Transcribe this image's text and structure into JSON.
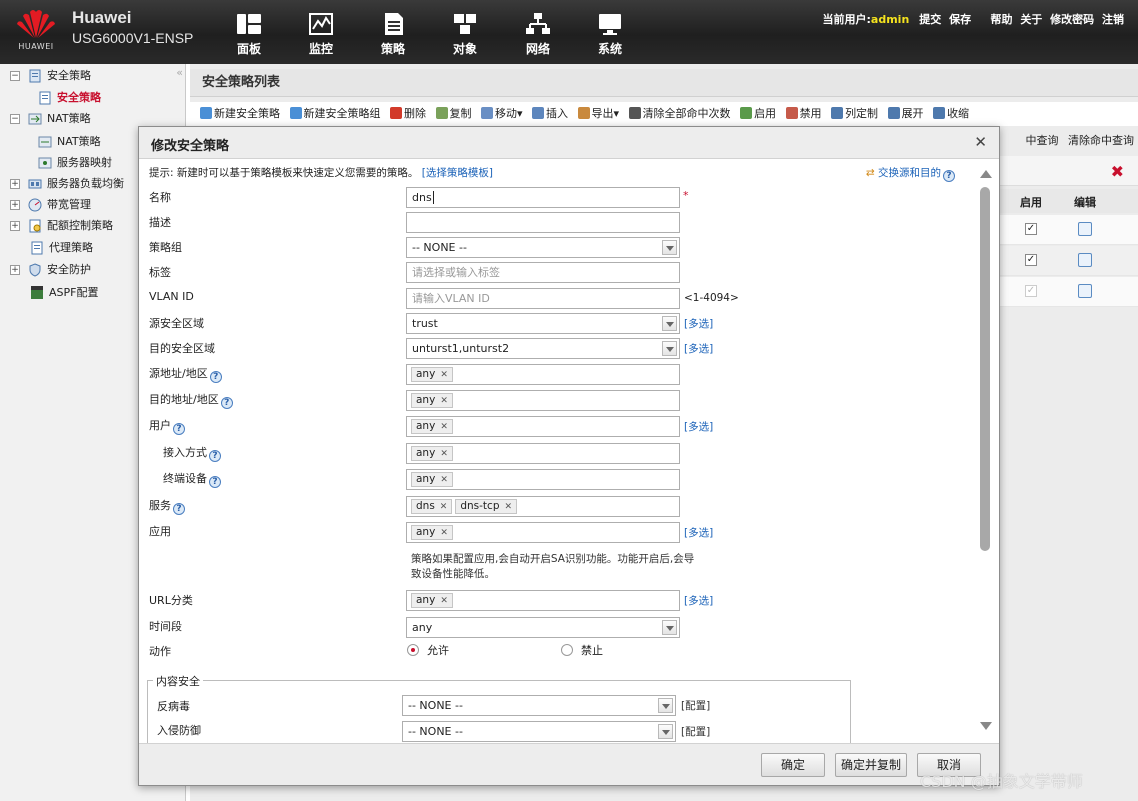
{
  "header": {
    "brand": "Huawei",
    "model": "USG6000V1-ENSP",
    "logo_text": "HUAWEI",
    "nav": [
      {
        "label": "面板",
        "icon": "dashboard-icon"
      },
      {
        "label": "监控",
        "icon": "monitor-icon"
      },
      {
        "label": "策略",
        "icon": "policy-icon"
      },
      {
        "label": "对象",
        "icon": "object-icon"
      },
      {
        "label": "网络",
        "icon": "network-icon"
      },
      {
        "label": "系统",
        "icon": "system-icon"
      }
    ],
    "current_user_label": "当前用户:",
    "current_user": "admin",
    "links": [
      "提交",
      "保存",
      "帮助",
      "关于",
      "修改密码",
      "注销"
    ],
    "accent_color": "#f5e31e"
  },
  "sidebar": {
    "items": [
      {
        "label": "安全策略",
        "expanded": true
      },
      {
        "label": "安全策略",
        "active": true
      },
      {
        "label": "NAT策略",
        "expanded": true
      },
      {
        "label": "NAT策略"
      },
      {
        "label": "服务器映射"
      },
      {
        "label": "服务器负载均衡",
        "expanded": false
      },
      {
        "label": "带宽管理",
        "expanded": false
      },
      {
        "label": "配额控制策略",
        "expanded": false
      },
      {
        "label": "代理策略"
      },
      {
        "label": "安全防护",
        "expanded": false
      },
      {
        "label": "ASPF配置"
      }
    ]
  },
  "main": {
    "title": "安全策略列表",
    "toolbar": [
      "新建安全策略",
      "新建安全策略组",
      "删除",
      "复制",
      "移动▾",
      "插入",
      "导出▾",
      "清除全部命中次数",
      "启用",
      "禁用",
      "列定制",
      "展开",
      "收缩"
    ],
    "query_links": [
      "中查询",
      "清除命中查询"
    ],
    "columns": [
      "启用",
      "编辑"
    ],
    "rows": [
      {
        "enabled": true,
        "disabled_style": false
      },
      {
        "enabled": true,
        "disabled_style": false
      },
      {
        "enabled": true,
        "disabled_style": true
      }
    ]
  },
  "dialog": {
    "title": "修改安全策略",
    "hint": "提示: 新建时可以基于策略模板来快速定义您需要的策略。",
    "template_link": "[选择策略模板]",
    "swap_link": "交换源和目的",
    "fields": {
      "name": {
        "label": "名称",
        "value": "dns",
        "required_mark": "*"
      },
      "desc": {
        "label": "描述",
        "value": ""
      },
      "group": {
        "label": "策略组",
        "value": "-- NONE --"
      },
      "tag": {
        "label": "标签",
        "placeholder": "请选择或输入标签"
      },
      "vlan": {
        "label": "VLAN ID",
        "placeholder": "请输入VLAN ID",
        "range": "<1-4094>"
      },
      "src_zone": {
        "label": "源安全区域",
        "value": "trust"
      },
      "dst_zone": {
        "label": "目的安全区域",
        "value": "unturst1,unturst2"
      },
      "src_addr": {
        "label": "源地址/地区",
        "tags": [
          "any"
        ]
      },
      "dst_addr": {
        "label": "目的地址/地区",
        "tags": [
          "any"
        ]
      },
      "user": {
        "label": "用户",
        "tags": [
          "any"
        ]
      },
      "access": {
        "label": "接入方式",
        "tags": [
          "any"
        ]
      },
      "device": {
        "label": "终端设备",
        "tags": [
          "any"
        ]
      },
      "service": {
        "label": "服务",
        "tags": [
          "dns",
          "dns-tcp"
        ]
      },
      "app": {
        "label": "应用",
        "tags": [
          "any"
        ]
      },
      "app_note": "策略如果配置应用,会自动开启SA识别功能。功能开启后,会导致设备性能降低。",
      "url": {
        "label": "URL分类",
        "tags": [
          "any"
        ]
      },
      "time": {
        "label": "时间段",
        "value": "any"
      },
      "action": {
        "label": "动作",
        "options": [
          "允许",
          "禁止"
        ],
        "selected": "允许"
      }
    },
    "multi_select": "[多选]",
    "content_security": {
      "title": "内容安全",
      "antivirus": {
        "label": "反病毒",
        "value": "-- NONE --",
        "config": "[配置]"
      },
      "ips": {
        "label": "入侵防御",
        "value": "-- NONE --",
        "config": "[配置]"
      }
    },
    "buttons": {
      "ok": "确定",
      "ok_copy": "确定并复制",
      "cancel": "取消"
    }
  },
  "watermark": "CSDN @抽象文学带师"
}
